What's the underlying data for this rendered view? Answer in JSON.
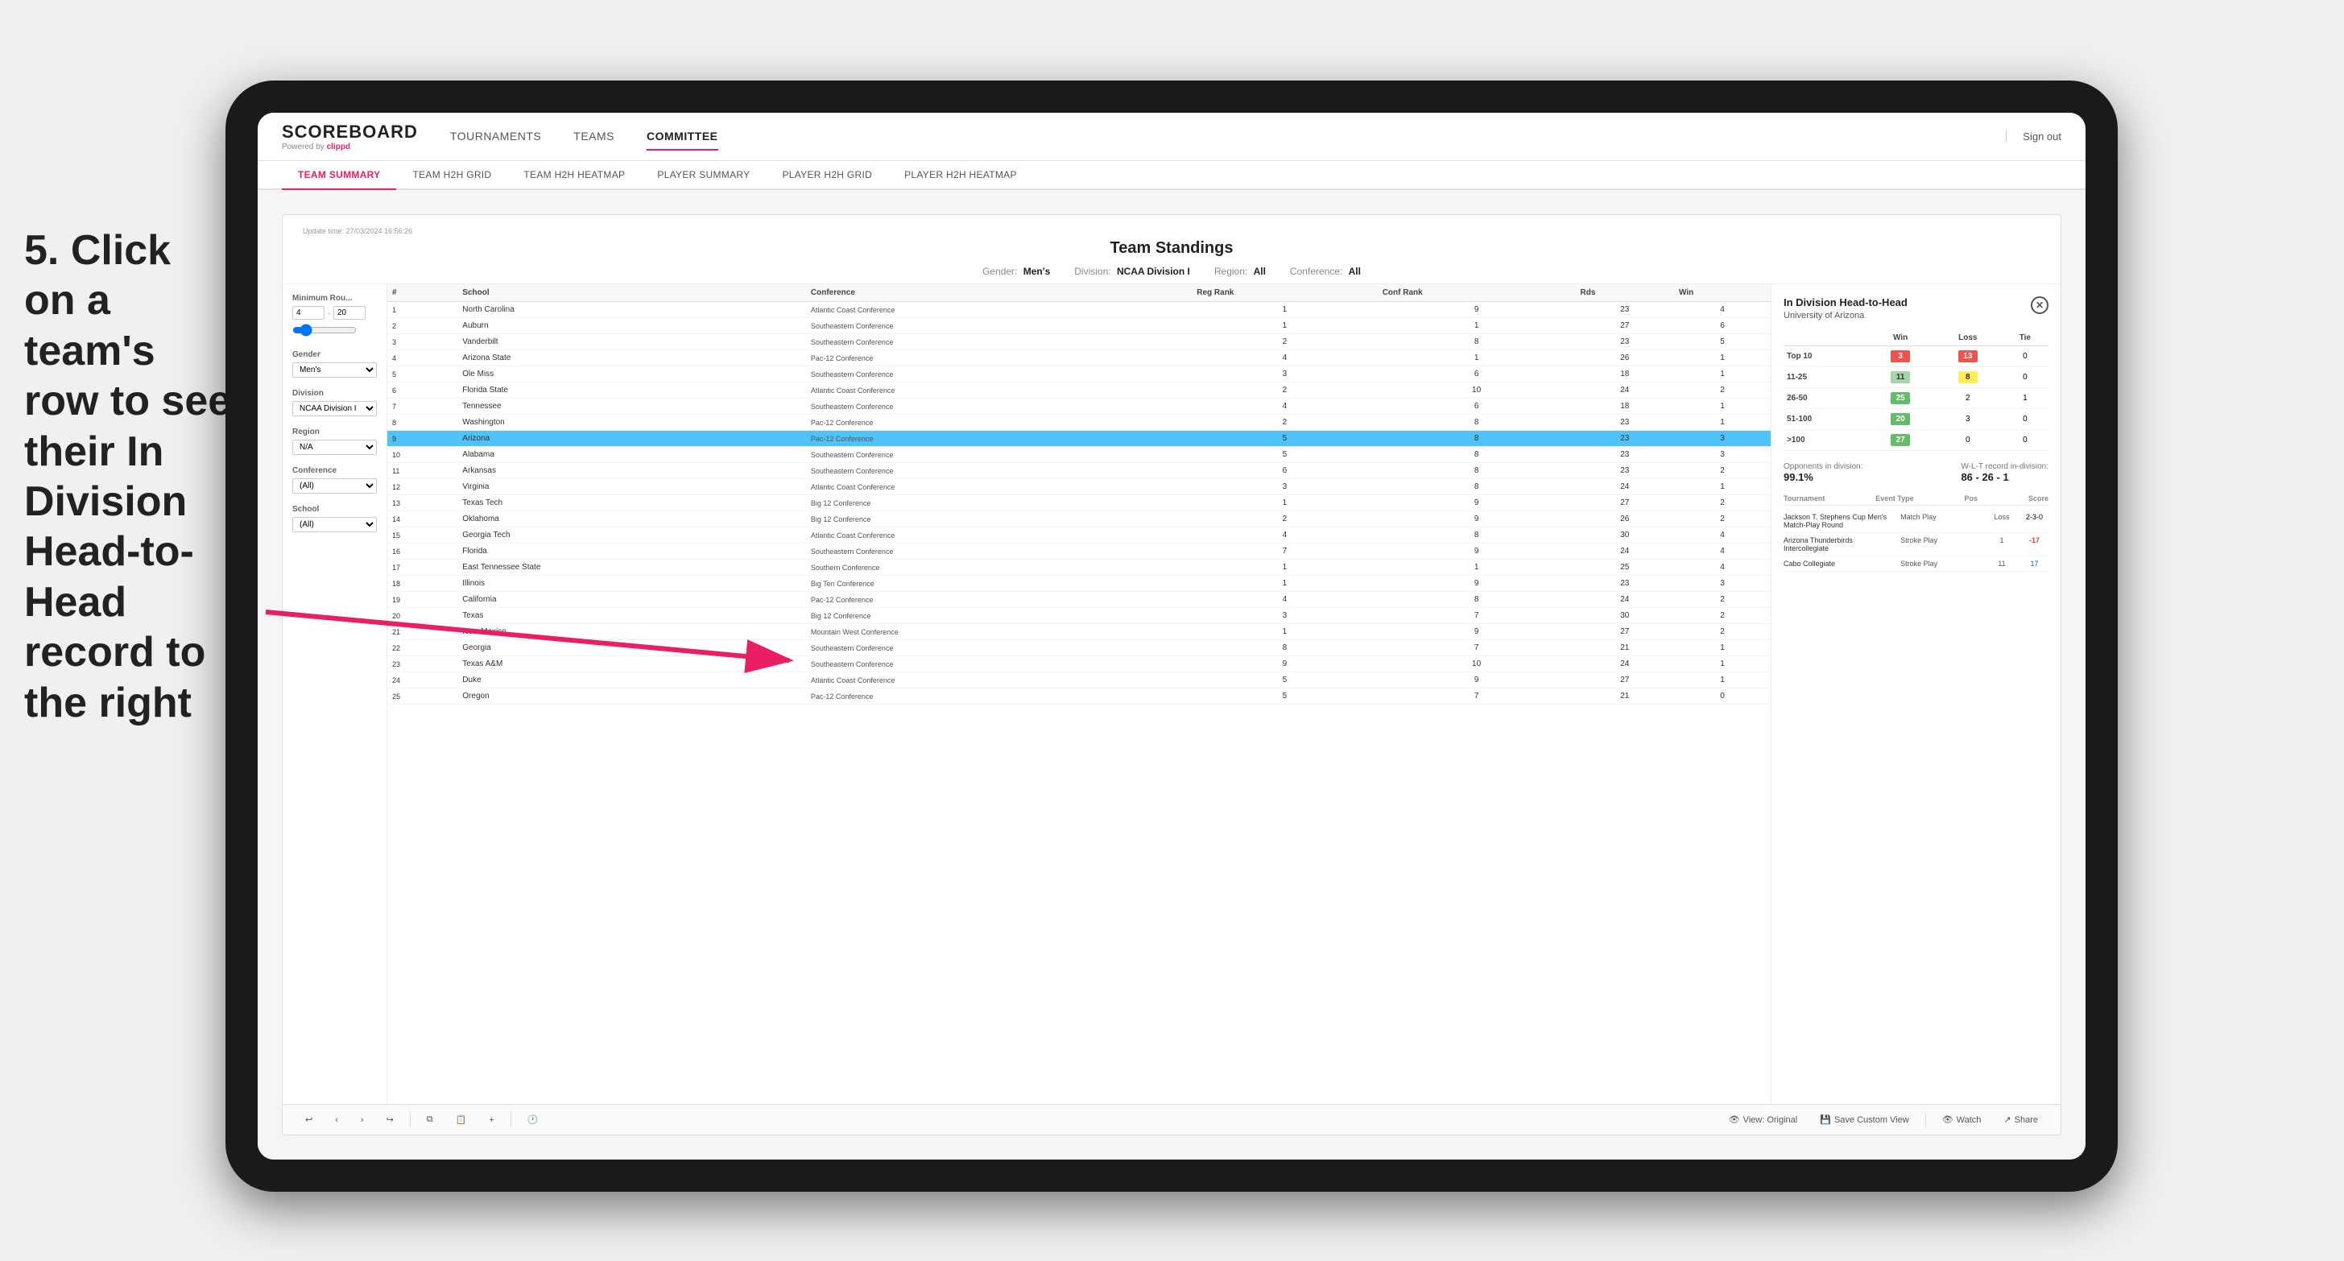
{
  "annotation": {
    "text": "5. Click on a team's row to see their In Division Head-to-Head record to the right"
  },
  "tablet": {
    "topNav": {
      "logo": "SCOREBOARD",
      "logoSub": "Powered by clippd",
      "links": [
        {
          "label": "TOURNAMENTS",
          "active": false
        },
        {
          "label": "TEAMS",
          "active": false
        },
        {
          "label": "COMMITTEE",
          "active": true
        }
      ],
      "signOut": "Sign out"
    },
    "subNav": [
      {
        "label": "TEAM SUMMARY",
        "active": true
      },
      {
        "label": "TEAM H2H GRID",
        "active": false
      },
      {
        "label": "TEAM H2H HEATMAP",
        "active": false
      },
      {
        "label": "PLAYER SUMMARY",
        "active": false
      },
      {
        "label": "PLAYER H2H GRID",
        "active": false
      },
      {
        "label": "PLAYER H2H HEATMAP",
        "active": false
      }
    ],
    "content": {
      "updateTime": "Update time: 27/03/2024 16:56:26",
      "panelTitle": "Team Standings",
      "filters": {
        "gender": {
          "label": "Gender:",
          "value": "Men's"
        },
        "division": {
          "label": "Division:",
          "value": "NCAA Division I"
        },
        "region": {
          "label": "Region:",
          "value": "All"
        },
        "conference": {
          "label": "Conference:",
          "value": "All"
        }
      },
      "sidebarFilters": {
        "minRounds": {
          "label": "Minimum Rou...",
          "min": "4",
          "max": "20"
        },
        "gender": {
          "label": "Gender",
          "value": "Men's"
        },
        "division": {
          "label": "Division",
          "value": "NCAA Division I"
        },
        "region": {
          "label": "Region",
          "value": "N/A"
        },
        "conference": {
          "label": "Conference",
          "value": "(All)"
        },
        "school": {
          "label": "School",
          "value": "(All)"
        }
      },
      "tableHeaders": [
        "#",
        "School",
        "Conference",
        "Reg Rank",
        "Conf Rank",
        "Rds",
        "Win"
      ],
      "tableRows": [
        {
          "rank": 1,
          "school": "North Carolina",
          "conference": "Atlantic Coast Conference",
          "regRank": 1,
          "confRank": 9,
          "rds": 23,
          "win": 4
        },
        {
          "rank": 2,
          "school": "Auburn",
          "conference": "Southeastern Conference",
          "regRank": 1,
          "confRank": 1,
          "rds": 27,
          "win": 6
        },
        {
          "rank": 3,
          "school": "Vanderbilt",
          "conference": "Southeastern Conference",
          "regRank": 2,
          "confRank": 8,
          "rds": 23,
          "win": 5
        },
        {
          "rank": 4,
          "school": "Arizona State",
          "conference": "Pac-12 Conference",
          "regRank": 4,
          "confRank": 1,
          "rds": 26,
          "win": 1
        },
        {
          "rank": 5,
          "school": "Ole Miss",
          "conference": "Southeastern Conference",
          "regRank": 3,
          "confRank": 6,
          "rds": 18,
          "win": 1
        },
        {
          "rank": 6,
          "school": "Florida State",
          "conference": "Atlantic Coast Conference",
          "regRank": 2,
          "confRank": 10,
          "rds": 24,
          "win": 2
        },
        {
          "rank": 7,
          "school": "Tennessee",
          "conference": "Southeastern Conference",
          "regRank": 4,
          "confRank": 6,
          "rds": 18,
          "win": 1
        },
        {
          "rank": 8,
          "school": "Washington",
          "conference": "Pac-12 Conference",
          "regRank": 2,
          "confRank": 8,
          "rds": 23,
          "win": 1
        },
        {
          "rank": 9,
          "school": "Arizona",
          "conference": "Pac-12 Conference",
          "regRank": 5,
          "confRank": 8,
          "rds": 23,
          "win": 3,
          "selected": true
        },
        {
          "rank": 10,
          "school": "Alabama",
          "conference": "Southeastern Conference",
          "regRank": 5,
          "confRank": 8,
          "rds": 23,
          "win": 3
        },
        {
          "rank": 11,
          "school": "Arkansas",
          "conference": "Southeastern Conference",
          "regRank": 6,
          "confRank": 8,
          "rds": 23,
          "win": 2
        },
        {
          "rank": 12,
          "school": "Virginia",
          "conference": "Atlantic Coast Conference",
          "regRank": 3,
          "confRank": 8,
          "rds": 24,
          "win": 1
        },
        {
          "rank": 13,
          "school": "Texas Tech",
          "conference": "Big 12 Conference",
          "regRank": 1,
          "confRank": 9,
          "rds": 27,
          "win": 2
        },
        {
          "rank": 14,
          "school": "Oklahoma",
          "conference": "Big 12 Conference",
          "regRank": 2,
          "confRank": 9,
          "rds": 26,
          "win": 2
        },
        {
          "rank": 15,
          "school": "Georgia Tech",
          "conference": "Atlantic Coast Conference",
          "regRank": 4,
          "confRank": 8,
          "rds": 30,
          "win": 4
        },
        {
          "rank": 16,
          "school": "Florida",
          "conference": "Southeastern Conference",
          "regRank": 7,
          "confRank": 9,
          "rds": 24,
          "win": 4
        },
        {
          "rank": 17,
          "school": "East Tennessee State",
          "conference": "Southern Conference",
          "regRank": 1,
          "confRank": 1,
          "rds": 25,
          "win": 4
        },
        {
          "rank": 18,
          "school": "Illinois",
          "conference": "Big Ten Conference",
          "regRank": 1,
          "confRank": 9,
          "rds": 23,
          "win": 3
        },
        {
          "rank": 19,
          "school": "California",
          "conference": "Pac-12 Conference",
          "regRank": 4,
          "confRank": 8,
          "rds": 24,
          "win": 2
        },
        {
          "rank": 20,
          "school": "Texas",
          "conference": "Big 12 Conference",
          "regRank": 3,
          "confRank": 7,
          "rds": 30,
          "win": 2
        },
        {
          "rank": 21,
          "school": "New Mexico",
          "conference": "Mountain West Conference",
          "regRank": 1,
          "confRank": 9,
          "rds": 27,
          "win": 2
        },
        {
          "rank": 22,
          "school": "Georgia",
          "conference": "Southeastern Conference",
          "regRank": 8,
          "confRank": 7,
          "rds": 21,
          "win": 1
        },
        {
          "rank": 23,
          "school": "Texas A&M",
          "conference": "Southeastern Conference",
          "regRank": 9,
          "confRank": 10,
          "rds": 24,
          "win": 1
        },
        {
          "rank": 24,
          "school": "Duke",
          "conference": "Atlantic Coast Conference",
          "regRank": 5,
          "confRank": 9,
          "rds": 27,
          "win": 1
        },
        {
          "rank": 25,
          "school": "Oregon",
          "conference": "Pac-12 Conference",
          "regRank": 5,
          "confRank": 7,
          "rds": 21,
          "win": 0
        }
      ],
      "h2h": {
        "title": "In Division Head-to-Head",
        "school": "University of Arizona",
        "tableHeaders": [
          "",
          "Win",
          "Loss",
          "Tie"
        ],
        "rows": [
          {
            "range": "Top 10",
            "win": 3,
            "loss": 13,
            "tie": 0,
            "winClass": "cell-red",
            "lossClass": "cell-red"
          },
          {
            "range": "11-25",
            "win": 11,
            "loss": 8,
            "tie": 0,
            "winClass": "cell-light-green",
            "lossClass": "cell-yellow"
          },
          {
            "range": "26-50",
            "win": 25,
            "loss": 2,
            "tie": 1,
            "winClass": "cell-green",
            "lossClass": ""
          },
          {
            "range": "51-100",
            "win": 20,
            "loss": 3,
            "tie": 0,
            "winClass": "cell-green",
            "lossClass": ""
          },
          {
            "range": ">100",
            "win": 27,
            "loss": 0,
            "tie": 0,
            "winClass": "cell-green",
            "lossClass": ""
          }
        ],
        "opponentsLabel": "Opponents in division:",
        "opponentsValue": "99.1%",
        "wltLabel": "W-L-T record in-division:",
        "wltValue": "86 - 26 - 1",
        "tournamentHeaders": [
          "Tournament",
          "Event Type",
          "Pos",
          "Score"
        ],
        "tournaments": [
          {
            "name": "Jackson T. Stephens Cup Men's Match-Play Round",
            "eventType": "Match Play",
            "pos": "Loss",
            "score": "2-3-0"
          },
          {
            "name": "Arizona Thunderbirds Intercollegiate",
            "eventType": "Stroke Play",
            "pos": "1",
            "score": "-17"
          },
          {
            "name": "Cabo Collegiate",
            "eventType": "Stroke Play",
            "pos": "11",
            "score": "17"
          }
        ]
      },
      "toolbar": {
        "undoLabel": "↩",
        "redoLabel": "↪",
        "viewOriginal": "View: Original",
        "saveCustomView": "Save Custom View",
        "watch": "Watch",
        "share": "Share"
      }
    }
  }
}
